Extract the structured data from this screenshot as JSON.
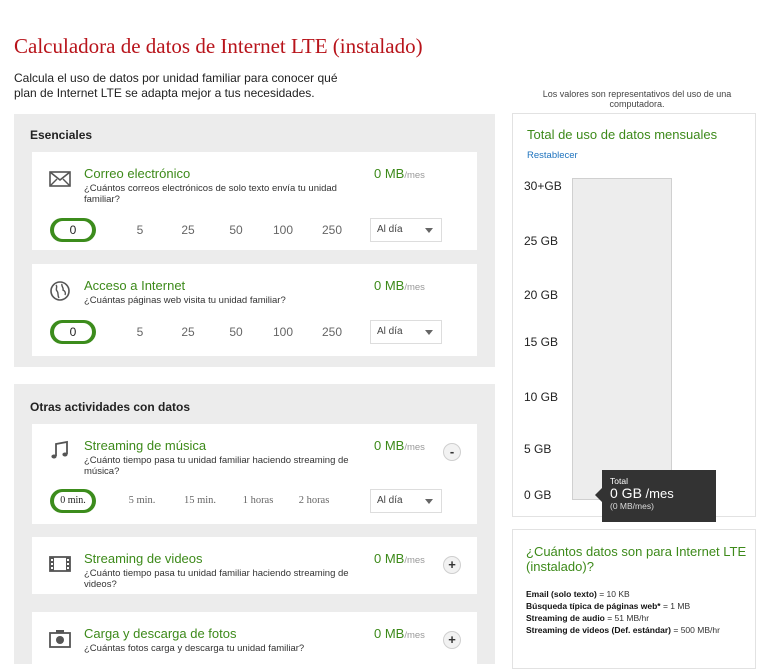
{
  "title": "Calculadora de datos de Internet LTE (instalado)",
  "intro": "Calcula el uso de datos por unidad familiar para conocer qué plan de Internet LTE se adapta mejor a tus necesidades.",
  "note": "Los valores son representativos del uso de una computadora.",
  "essentials": {
    "title": "Esenciales",
    "email": {
      "title": "Correo electrónico",
      "question": "¿Cuántos correos electrónicos de solo texto envía tu unidad familiar?",
      "mb": "0 MB",
      "unit": "/mes",
      "options": [
        "0",
        "5",
        "25",
        "50",
        "100",
        "250"
      ],
      "selected": "0",
      "frequency": "Al día"
    },
    "internet": {
      "title": "Acceso a Internet",
      "question": "¿Cuántas páginas web visita tu unidad familiar?",
      "mb": "0 MB",
      "unit": "/mes",
      "options": [
        "0",
        "5",
        "25",
        "50",
        "100",
        "250"
      ],
      "selected": "0",
      "frequency": "Al día"
    }
  },
  "other": {
    "title": "Otras actividades con datos",
    "music": {
      "title": "Streaming de música",
      "question": "¿Cuánto tiempo pasa tu unidad familiar haciendo streaming de música?",
      "mb": "0 MB",
      "unit": "/mes",
      "toggle": "-",
      "options": [
        "0 min.",
        "5 min.",
        "15 min.",
        "1 horas",
        "2 horas"
      ],
      "selected": "0 min.",
      "frequency": "Al día"
    },
    "video": {
      "title": "Streaming de videos",
      "question": "¿Cuánto tiempo pasa tu unidad familiar haciendo streaming de videos?",
      "mb": "0 MB",
      "unit": "/mes",
      "toggle": "+"
    },
    "photos": {
      "title": "Carga y descarga de fotos",
      "question": "¿Cuántas fotos carga y descarga tu unidad familiar?",
      "mb": "0 MB",
      "unit": "/mes",
      "toggle": "+"
    }
  },
  "total": {
    "title": "Total de uso de datos mensuales",
    "reset": "Restablecer",
    "scale": [
      "30+GB",
      "25 GB",
      "20 GB",
      "15 GB",
      "10 GB",
      "5 GB",
      "0 GB"
    ],
    "level": 0,
    "tooltip_label": "Total",
    "tooltip_value": "0 GB",
    "tooltip_unit": "/mes",
    "tooltip_sub": "(0 MB/mes)"
  },
  "info": {
    "title": "¿Cuántos datos son para Internet LTE (instalado)?",
    "items": [
      {
        "label": "Email (solo texto)",
        "value": " = 10 KB"
      },
      {
        "label": "Búsqueda típica de páginas web*",
        "value": " = 1 MB"
      },
      {
        "label": "Streaming de audio",
        "value": " = 51 MB/hr"
      },
      {
        "label": "Streaming de videos (Def. estándar)",
        "value": " = 500 MB/hr"
      }
    ]
  },
  "colors": {
    "title_red": "#b8141b",
    "accent_green": "#3c8c1c",
    "link_blue": "#1e73be",
    "tooltip_bg": "#333333"
  }
}
